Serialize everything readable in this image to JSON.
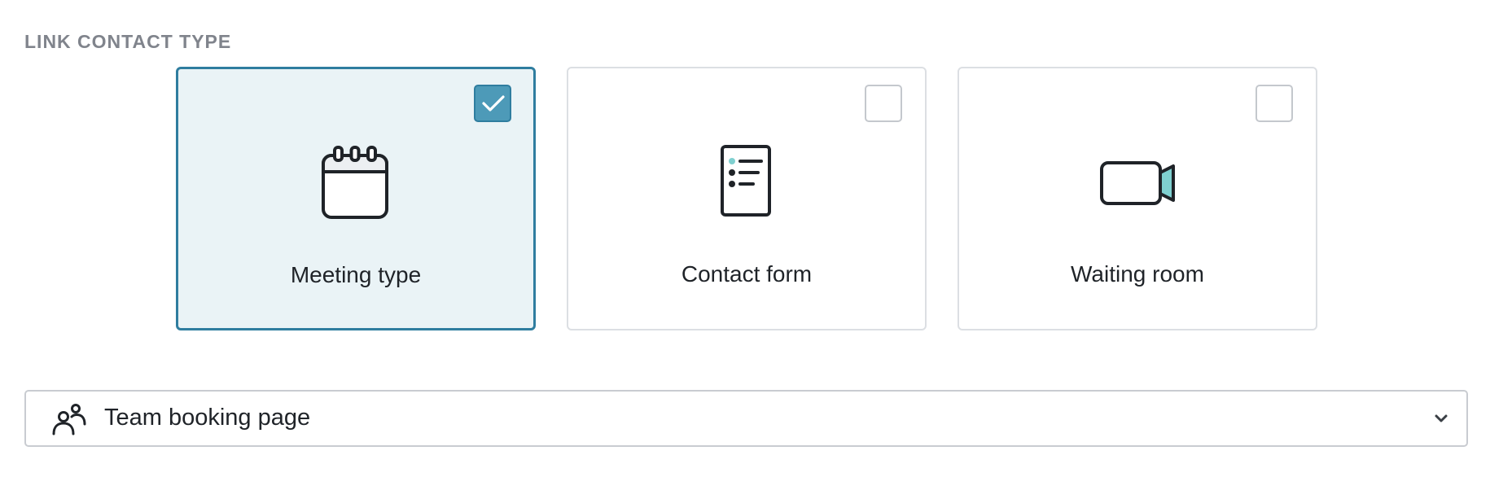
{
  "section": {
    "label": "LINK CONTACT TYPE"
  },
  "cards": [
    {
      "label": "Meeting type",
      "icon": "calendar-icon",
      "selected": true
    },
    {
      "label": "Contact form",
      "icon": "form-icon",
      "selected": false
    },
    {
      "label": "Waiting room",
      "icon": "video-camera-icon",
      "selected": false
    }
  ],
  "dropdown": {
    "value": "Team booking page",
    "icon": "team-icon"
  },
  "colors": {
    "accent": "#2f7d9f",
    "selected_bg": "#eaf3f6",
    "check_fill": "#4d9ab8",
    "icon_teal": "#7fd0d0"
  }
}
